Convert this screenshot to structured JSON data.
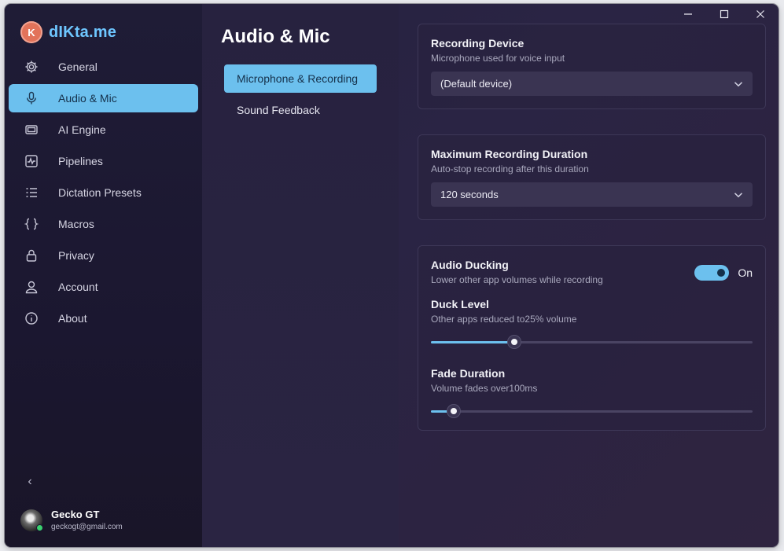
{
  "app": {
    "name": "dIKta.me",
    "logo_text": "K"
  },
  "nav": {
    "items": [
      {
        "label": "General",
        "icon": "gear-icon"
      },
      {
        "label": "Audio & Mic",
        "icon": "microphone-icon",
        "active": true
      },
      {
        "label": "AI Engine",
        "icon": "chip-icon"
      },
      {
        "label": "Pipelines",
        "icon": "pulse-icon"
      },
      {
        "label": "Dictation Presets",
        "icon": "list-icon"
      },
      {
        "label": "Macros",
        "icon": "braces-icon"
      },
      {
        "label": "Privacy",
        "icon": "lock-icon"
      },
      {
        "label": "Account",
        "icon": "person-icon"
      },
      {
        "label": "About",
        "icon": "info-icon"
      }
    ],
    "collapse_glyph": "‹"
  },
  "user": {
    "name": "Gecko GT",
    "email": "geckogt@gmail.com",
    "status": "online"
  },
  "page": {
    "title": "Audio & Mic",
    "subnav": [
      {
        "label": "Microphone & Recording",
        "active": true
      },
      {
        "label": "Sound Feedback"
      }
    ]
  },
  "recording_device": {
    "title": "Recording Device",
    "subtitle": "Microphone used for voice input",
    "value": "(Default device)"
  },
  "max_duration": {
    "title": "Maximum Recording Duration",
    "subtitle": "Auto-stop recording after this duration",
    "value": "120 seconds"
  },
  "ducking": {
    "title": "Audio Ducking",
    "subtitle": "Lower other app volumes while recording",
    "toggle_label": "On",
    "enabled": true,
    "duck_level": {
      "title": "Duck Level",
      "subtitle": "Other apps reduced to25% volume",
      "fraction": 0.26
    },
    "fade_duration": {
      "title": "Fade Duration",
      "subtitle": "Volume fades over100ms",
      "fraction": 0.07
    }
  },
  "colors": {
    "accent": "#6cc0ee",
    "brand": "#6ec6ff",
    "logo": "#e2735a"
  }
}
